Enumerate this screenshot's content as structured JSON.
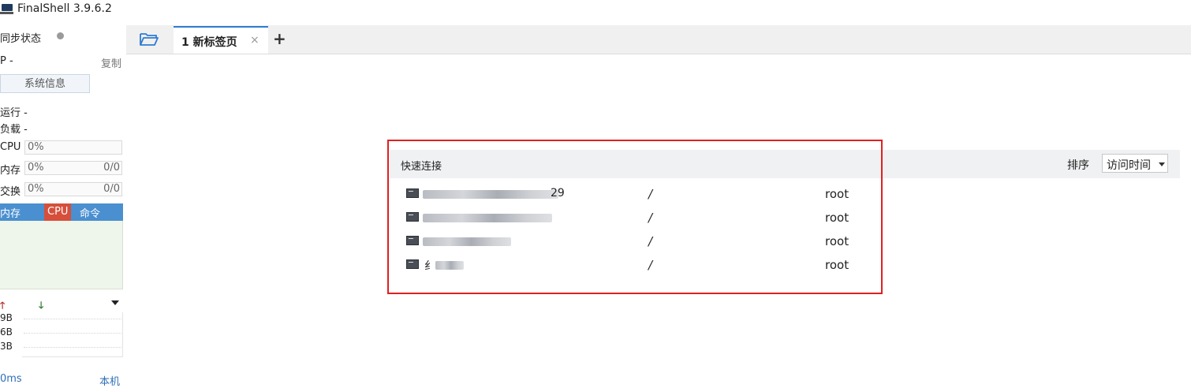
{
  "window": {
    "title": "FinalShell 3.9.6.2"
  },
  "sidebar": {
    "sync_label": "同步状态",
    "ip_label": "P -",
    "copy_label": "复制",
    "sysinfo_button": "系统信息",
    "uptime_label": "运行 -",
    "load_label": "负载 -",
    "meters": [
      {
        "label": "CPU",
        "value": "0%",
        "total": ""
      },
      {
        "label": "内存",
        "value": "0%",
        "total": "0/0"
      },
      {
        "label": "交换",
        "value": "0%",
        "total": "0/0"
      }
    ],
    "proc_tabs": {
      "mem": "内存",
      "cpu": "CPU",
      "cmd": "命令"
    },
    "net_labels": [
      "9B",
      "6B",
      "3B"
    ],
    "latency": "0ms",
    "local_label": "本机"
  },
  "tabs": [
    {
      "label": "1 新标签页"
    }
  ],
  "quick_connect": {
    "title": "快速连接",
    "sort_label": "排序",
    "sort_value": "访问时间",
    "rows": [
      {
        "host_visible": "29",
        "path": "/",
        "user": "root"
      },
      {
        "host_visible": "",
        "path": "/",
        "user": "root"
      },
      {
        "host_visible": "",
        "path": "/",
        "user": "root"
      },
      {
        "host_visible": "纟",
        "path": "/",
        "user": "root"
      }
    ]
  },
  "colors": {
    "accent": "#2f7bd3",
    "proc_tab_bar": "#4a8fd0",
    "cpu_tab": "#d64f3b",
    "highlight_border": "#e02020",
    "link": "#2f6fb8"
  }
}
